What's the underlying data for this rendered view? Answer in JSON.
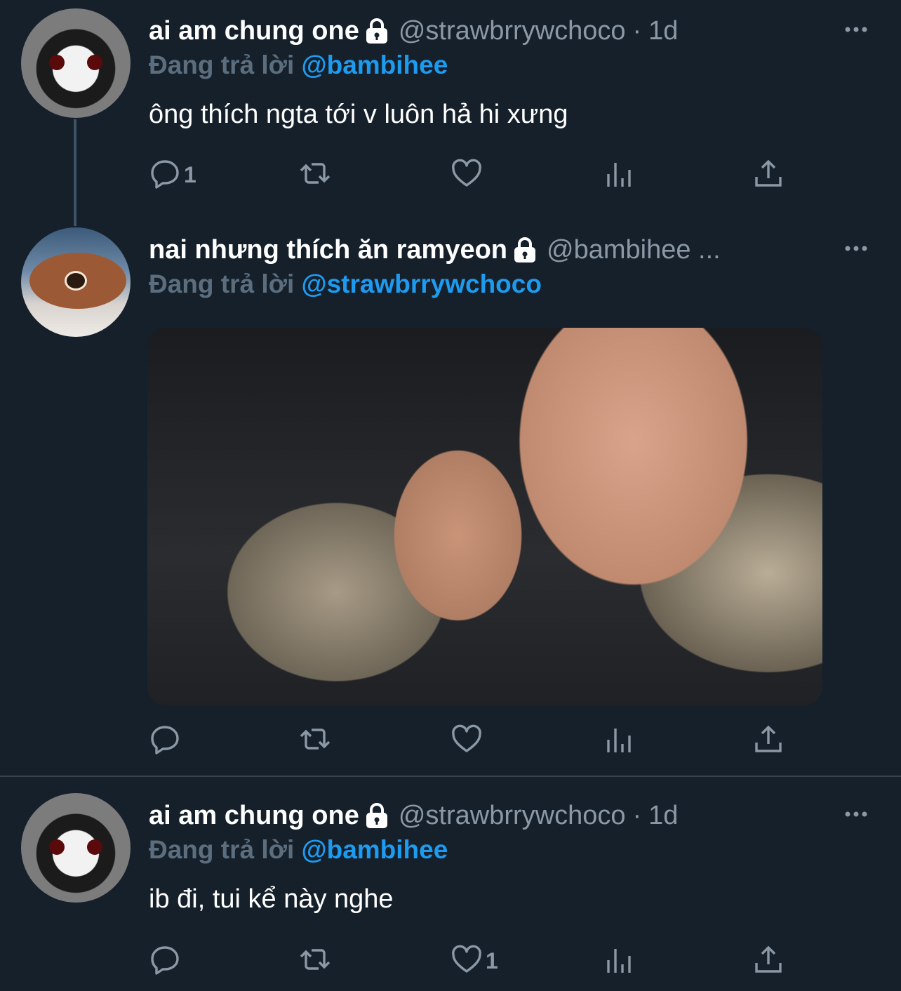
{
  "tweets": [
    {
      "display_name": "ai am chung one",
      "handle": "@strawbrrywchoco",
      "separator": "·",
      "time": "1d",
      "reply_label": "Đang trả lời",
      "reply_to": "@bambihee",
      "text": "ông thích ngta tới v luôn hả hi xưng",
      "reply_count": "1",
      "like_count": ""
    },
    {
      "display_name": "nai nhưng thích ăn ramyeon",
      "handle": "@bambihee ...",
      "reply_label": "Đang trả lời",
      "reply_to": "@strawbrrywchoco",
      "reply_count": "",
      "like_count": ""
    },
    {
      "display_name": "ai am chung one",
      "handle": "@strawbrrywchoco",
      "separator": "·",
      "time": "1d",
      "reply_label": "Đang trả lời",
      "reply_to": "@bambihee",
      "text": "ib đi, tui kể này nghe",
      "reply_count": "",
      "like_count": "1"
    }
  ],
  "colors": {
    "background": "#15202b",
    "mention": "#1d9bf0",
    "secondary_text": "#8b98a5"
  },
  "icons": [
    "reply-icon",
    "retweet-icon",
    "like-icon",
    "analytics-icon",
    "share-icon",
    "lock-icon",
    "more-icon"
  ]
}
